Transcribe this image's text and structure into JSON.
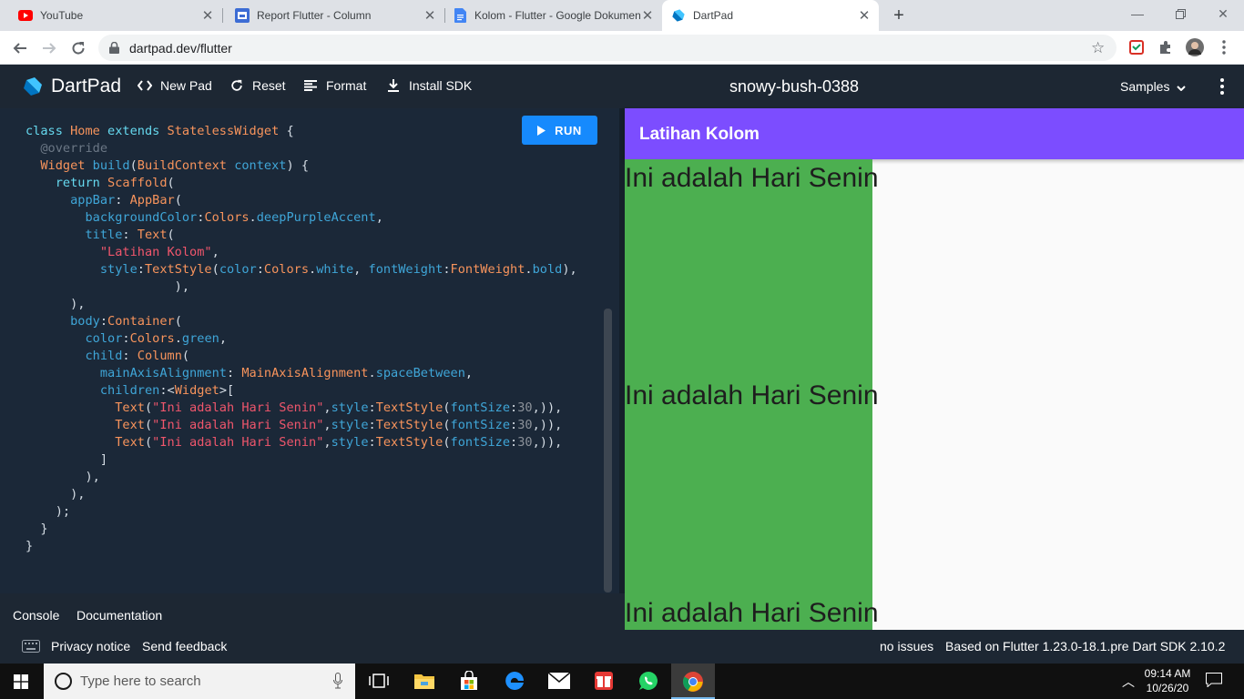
{
  "browser": {
    "tabs": [
      {
        "title": "YouTube",
        "icon": "youtube-icon",
        "active": false
      },
      {
        "title": "Report Flutter - Column",
        "icon": "google-sites-icon",
        "active": false
      },
      {
        "title": "Kolom - Flutter - Google Dokumen",
        "icon": "google-docs-icon",
        "active": false
      },
      {
        "title": "DartPad",
        "icon": "dart-icon",
        "active": true
      }
    ],
    "url": "dartpad.dev/flutter"
  },
  "dartpad": {
    "brand": "DartPad",
    "buttons": {
      "new_pad": "New Pad",
      "reset": "Reset",
      "format": "Format",
      "install_sdk": "Install SDK",
      "run": "RUN",
      "samples": "Samples"
    },
    "pad_name": "snowy-bush-0388",
    "code_lines": [
      [
        [
          "k",
          "class "
        ],
        [
          "t",
          "Home "
        ],
        [
          "k",
          "extends "
        ],
        [
          "t",
          "StatelessWidget "
        ],
        [
          "w",
          "{"
        ]
      ],
      [
        [
          "c",
          "  @override"
        ]
      ],
      [
        [
          "t",
          "  Widget "
        ],
        [
          "p",
          "build"
        ],
        [
          "w",
          "("
        ],
        [
          "t",
          "BuildContext "
        ],
        [
          "p",
          "context"
        ],
        [
          "w",
          ") {"
        ]
      ],
      [
        [
          "k",
          "    return "
        ],
        [
          "t",
          "Scaffold"
        ],
        [
          "w",
          "("
        ]
      ],
      [
        [
          "p",
          "      appBar"
        ],
        [
          "w",
          ": "
        ],
        [
          "t",
          "AppBar"
        ],
        [
          "w",
          "("
        ]
      ],
      [
        [
          "p",
          "        backgroundColor"
        ],
        [
          "w",
          ":"
        ],
        [
          "t",
          "Colors"
        ],
        [
          "w",
          "."
        ],
        [
          "p",
          "deepPurpleAccent"
        ],
        [
          "w",
          ","
        ]
      ],
      [
        [
          "p",
          "        title"
        ],
        [
          "w",
          ": "
        ],
        [
          "t",
          "Text"
        ],
        [
          "w",
          "("
        ]
      ],
      [
        [
          "s",
          "          \"Latihan Kolom\""
        ],
        [
          "w",
          ","
        ]
      ],
      [
        [
          "p",
          "          style"
        ],
        [
          "w",
          ":"
        ],
        [
          "t",
          "TextStyle"
        ],
        [
          "w",
          "("
        ],
        [
          "p",
          "color"
        ],
        [
          "w",
          ":"
        ],
        [
          "t",
          "Colors"
        ],
        [
          "w",
          "."
        ],
        [
          "p",
          "white"
        ],
        [
          "w",
          ", "
        ],
        [
          "p",
          "fontWeight"
        ],
        [
          "w",
          ":"
        ],
        [
          "t",
          "FontWeight"
        ],
        [
          "w",
          "."
        ],
        [
          "p",
          "bold"
        ],
        [
          "w",
          "),"
        ]
      ],
      [
        [
          "w",
          "                    ),"
        ]
      ],
      [
        [
          "w",
          "      ),"
        ]
      ],
      [
        [
          "p",
          "      body"
        ],
        [
          "w",
          ":"
        ],
        [
          "t",
          "Container"
        ],
        [
          "w",
          "("
        ]
      ],
      [
        [
          "p",
          "        color"
        ],
        [
          "w",
          ":"
        ],
        [
          "t",
          "Colors"
        ],
        [
          "w",
          "."
        ],
        [
          "p",
          "green"
        ],
        [
          "w",
          ","
        ]
      ],
      [
        [
          "p",
          "        child"
        ],
        [
          "w",
          ": "
        ],
        [
          "t",
          "Column"
        ],
        [
          "w",
          "("
        ]
      ],
      [
        [
          "p",
          "          mainAxisAlignment"
        ],
        [
          "w",
          ": "
        ],
        [
          "t",
          "MainAxisAlignment"
        ],
        [
          "w",
          "."
        ],
        [
          "p",
          "spaceBetween"
        ],
        [
          "w",
          ","
        ]
      ],
      [
        [
          "p",
          "          children"
        ],
        [
          "w",
          ":<"
        ],
        [
          "t",
          "Widget"
        ],
        [
          "w",
          ">["
        ]
      ],
      [
        [
          "t",
          "            Text"
        ],
        [
          "w",
          "("
        ],
        [
          "s",
          "\"Ini adalah Hari Senin\""
        ],
        [
          "w",
          ","
        ],
        [
          "p",
          "style"
        ],
        [
          "w",
          ":"
        ],
        [
          "t",
          "TextStyle"
        ],
        [
          "w",
          "("
        ],
        [
          "p",
          "fontSize"
        ],
        [
          "w",
          ":"
        ],
        [
          "n",
          "30"
        ],
        [
          "w",
          ",)),"
        ]
      ],
      [
        [
          "t",
          "            Text"
        ],
        [
          "w",
          "("
        ],
        [
          "s",
          "\"Ini adalah Hari Senin\""
        ],
        [
          "w",
          ","
        ],
        [
          "p",
          "style"
        ],
        [
          "w",
          ":"
        ],
        [
          "t",
          "TextStyle"
        ],
        [
          "w",
          "("
        ],
        [
          "p",
          "fontSize"
        ],
        [
          "w",
          ":"
        ],
        [
          "n",
          "30"
        ],
        [
          "w",
          ",)),"
        ]
      ],
      [
        [
          "t",
          "            Text"
        ],
        [
          "w",
          "("
        ],
        [
          "s",
          "\"Ini adalah Hari Senin\""
        ],
        [
          "w",
          ","
        ],
        [
          "p",
          "style"
        ],
        [
          "w",
          ":"
        ],
        [
          "t",
          "TextStyle"
        ],
        [
          "w",
          "("
        ],
        [
          "p",
          "fontSize"
        ],
        [
          "w",
          ":"
        ],
        [
          "n",
          "30"
        ],
        [
          "w",
          ",)),"
        ]
      ],
      [
        [
          "w",
          "          ]"
        ]
      ],
      [
        [
          "w",
          "        ),"
        ]
      ],
      [
        [
          "w",
          "      ),"
        ]
      ],
      [
        [
          "w",
          "    );"
        ]
      ],
      [
        [
          "w",
          "  }"
        ]
      ],
      [
        [
          "w",
          "}"
        ]
      ]
    ],
    "console_tabs": [
      "Console",
      "Documentation"
    ],
    "output": {
      "appbar_title": "Latihan Kolom",
      "appbar_color": "#7c4dff",
      "body_color": "#4caf50",
      "texts": [
        "Ini adalah Hari Senin",
        "Ini adalah Hari Senin",
        "Ini adalah Hari Senin"
      ]
    },
    "status": {
      "privacy": "Privacy notice",
      "feedback": "Send feedback",
      "issues": "no issues",
      "version": "Based on Flutter 1.23.0-18.1.pre Dart SDK 2.10.2"
    }
  },
  "taskbar": {
    "search_placeholder": "Type here to search",
    "time": "09:14 AM",
    "date": "10/26/20"
  }
}
